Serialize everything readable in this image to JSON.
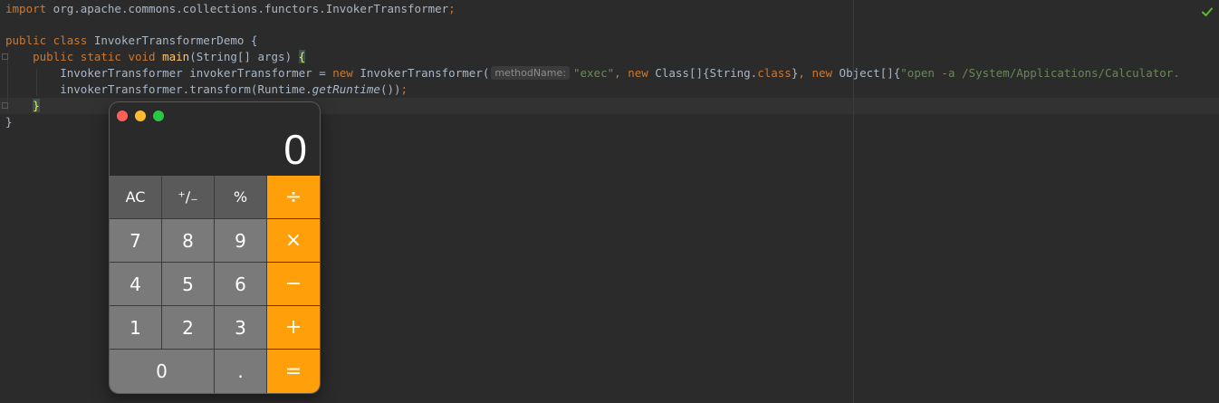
{
  "editor": {
    "line1": {
      "kw": "import",
      "rest": " org.apache.commons.collections.functors.InvokerTransformer",
      "semi": ";"
    },
    "line3": {
      "kw": "public class",
      "rest": " InvokerTransformerDemo {"
    },
    "line4": {
      "kw": "public static void",
      "sp": " ",
      "fn": "main",
      "rest": "(String[] args) ",
      "brace": "{"
    },
    "line5": {
      "decl": "InvokerTransformer invokerTransformer = ",
      "new1": "new",
      "ctor": " InvokerTransformer(",
      "hint": "methodName:",
      "arg1": "\"exec\"",
      "sep1": ", ",
      "new2": "new",
      "arr1": " Class[]{String.",
      "cls": "class",
      "arr1end": "}",
      "sep2": ", ",
      "new3": "new",
      "arr2": " Object[]{",
      "arg2": "\"open -a /System/Applications/Calculator."
    },
    "line6": {
      "pre": "invokerTransformer.transform(Runtime.",
      "call": "getRuntime",
      "post": "())",
      "semi": ";"
    },
    "line7": {
      "brace": "}"
    },
    "line8": {
      "brace": "}"
    },
    "status_icon": "check-icon",
    "colors": {
      "background": "#2b2b2b",
      "keyword": "#cc7832",
      "function": "#ffc66d",
      "string": "#6a8759",
      "text": "#a9b7c6"
    }
  },
  "calculator": {
    "display": "0",
    "keys": {
      "ac": "AC",
      "sign": "⁺∕₋",
      "percent": "%",
      "divide": "÷",
      "seven": "7",
      "eight": "8",
      "nine": "9",
      "multiply": "×",
      "four": "4",
      "five": "5",
      "six": "6",
      "minus": "−",
      "one": "1",
      "two": "2",
      "three": "3",
      "plus": "+",
      "zero": "0",
      "decimal": ".",
      "equals": "="
    },
    "colors": {
      "operator": "#ff9f0a",
      "function_key": "#5a5a5a",
      "number_key": "#7a7a7a",
      "close": "#fe5f57",
      "minimize": "#febc2e",
      "maximize": "#28c840"
    }
  }
}
